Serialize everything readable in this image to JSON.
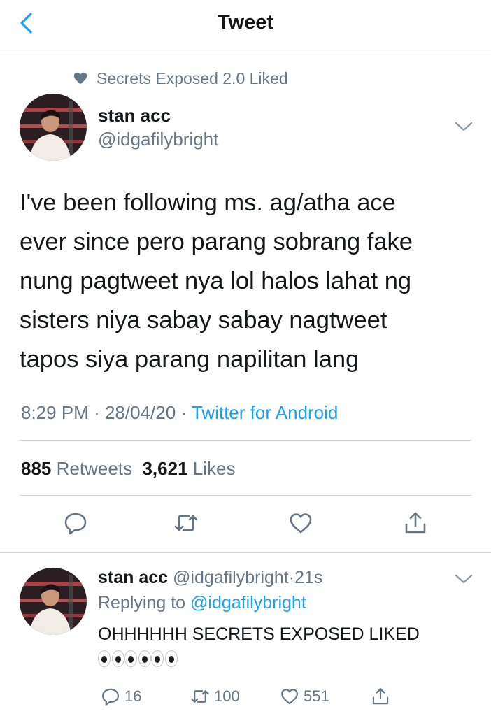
{
  "header": {
    "title": "Tweet",
    "back_icon": "chevron-left-icon"
  },
  "social_context": {
    "icon": "heart-icon",
    "text": "Secrets Exposed 2.0 Liked"
  },
  "tweet": {
    "author_name": "stan acc",
    "author_handle": "@idgafilybright",
    "text_lines": [
      "I've been following ms. ag/atha ace",
      "ever since pero parang sobrang fake",
      "nung pagtweet nya lol halos lahat ng",
      "sisters niya sabay sabay nagtweet",
      "tapos siya parang napilitan lang"
    ],
    "time": "8:29 PM",
    "date": "28/04/20",
    "separator": "·",
    "source": "Twitter for Android",
    "retweet_count": "885",
    "retweet_label": "Retweets",
    "like_count": "3,621",
    "like_label": "Likes"
  },
  "actions": [
    "reply-icon",
    "retweet-icon",
    "like-icon",
    "share-icon"
  ],
  "reply": {
    "author_name": "stan acc",
    "author_handle": "@idgafilybright",
    "separator": "·",
    "time_ago": "21s",
    "replying_prefix": "Replying to",
    "replying_to": "@idgafilybright",
    "text": "OHHHHHH SECRETS EXPOSED LIKED",
    "emoji": "👀👀👀",
    "reply_count": "16",
    "retweet_count": "100",
    "like_count": "551"
  },
  "colors": {
    "accent": "#1da1f2",
    "muted": "#657786",
    "text": "#14171a",
    "divider": "#cfd5da"
  }
}
